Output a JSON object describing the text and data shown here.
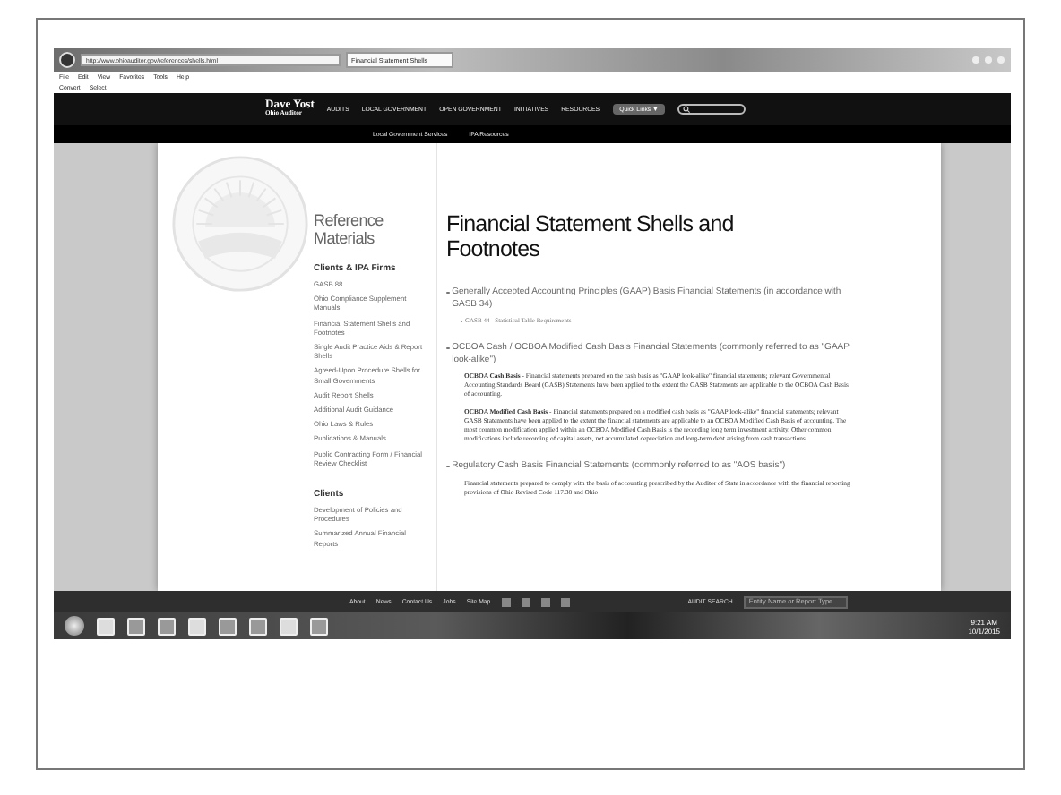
{
  "browser": {
    "url": "http://www.ohioauditor.gov/references/shells.html",
    "tab_title": "Financial Statement Shells",
    "menu": [
      "File",
      "Edit",
      "View",
      "Favorites",
      "Tools",
      "Help"
    ],
    "favorites": [
      "Convert",
      "Select"
    ]
  },
  "site": {
    "logo": {
      "name": "Dave Yost",
      "subtitle": "Ohio Auditor"
    },
    "nav": [
      "AUDITS",
      "LOCAL GOVERNMENT",
      "OPEN GOVERNMENT",
      "INITIATIVES",
      "RESOURCES"
    ],
    "quick_links": "Quick Links ▼",
    "subnav": [
      "Local Government Services",
      "IPA Resources"
    ]
  },
  "sidebar": {
    "title": "Reference Materials",
    "sections": [
      {
        "heading": "Clients & IPA Firms",
        "items": [
          "GASB 88",
          "Ohio Compliance Supplement Manuals",
          "Financial Statement Shells and Footnotes",
          "Single Audit Practice Aids & Report Shells",
          "Agreed-Upon Procedure Shells for Small Governments",
          "Audit Report Shells",
          "Additional Audit Guidance",
          "Ohio Laws & Rules",
          "Publications & Manuals",
          "Public Contracting Form / Financial Review Checklist"
        ]
      },
      {
        "heading": "Clients",
        "items": [
          "Development of Policies and Procedures",
          "Summarized Annual Financial Reports"
        ]
      }
    ]
  },
  "content": {
    "title": "Financial Statement Shells and Footnotes",
    "sections": [
      {
        "heading": "Generally Accepted Accounting Principles (GAAP) Basis Financial Statements (in accordance with GASB 34)",
        "links": [
          "GASB 44 - Statistical Table Requirements"
        ]
      },
      {
        "heading": "OCBOA Cash / OCBOA Modified Cash Basis Financial Statements (commonly referred to as \"GAAP look-alike\")",
        "paragraphs": [
          "**OCBOA Cash Basis** - Financial statements prepared on the cash basis as \"GAAP look-alike\" financial statements; relevant Governmental Accounting Standards Board (GASB) Statements have been applied to the extent the GASB Statements are applicable to the OCBOA Cash Basis of accounting.",
          "**OCBOA Modified Cash Basis** - Financial statements prepared on a modified cash basis as \"GAAP look-alike\" financial statements; relevant GASB Statements have been applied to the extent the financial statements are applicable to an OCBOA Modified Cash Basis of accounting. The most common modification applied within an OCBOA Modified Cash Basis is the recording long term investment activity. Other common modifications include recording of capital assets, net accumulated depreciation and long-term debt arising from cash transactions."
        ]
      },
      {
        "heading": "Regulatory Cash Basis Financial Statements (commonly referred to as \"AOS basis\")",
        "paragraphs": [
          "Financial statements prepared to comply with the basis of accounting prescribed by the Auditor of State in accordance with the financial reporting provisions of Ohio Revised Code 117.38 and Ohio"
        ]
      }
    ]
  },
  "footer": {
    "links": [
      "About",
      "News",
      "Contact Us",
      "Jobs",
      "Site Map"
    ],
    "search_label": "AUDIT SEARCH",
    "search_placeholder": "Entity Name or Report Type"
  },
  "taskbar": {
    "time": "9:21 AM",
    "date": "10/1/2015"
  }
}
